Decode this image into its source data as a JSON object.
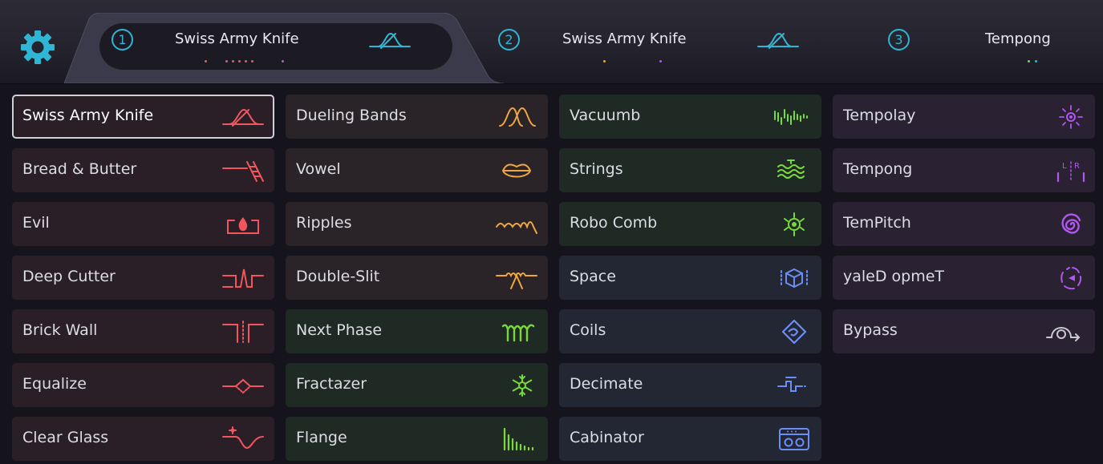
{
  "colors": {
    "red": "#f2555d",
    "orange": "#f0a640",
    "green": "#7ad93a",
    "blue": "#6c8df5",
    "purple": "#b156ee",
    "cyan": "#2fb6d4"
  },
  "top_bar": {
    "settings_icon": "gear-icon",
    "slots": [
      {
        "number": "1",
        "name": "Swiss Army Knife",
        "icon": "swiss-army-knife-icon",
        "active": true
      },
      {
        "number": "2",
        "name": "Swiss Army Knife",
        "icon": "swiss-army-knife-icon",
        "active": false
      },
      {
        "number": "3",
        "name": "Tempong",
        "icon": "tempong-icon",
        "active": false
      }
    ]
  },
  "modules": {
    "column_1": [
      {
        "label": "Swiss Army Knife",
        "icon": "swiss-army-knife-icon",
        "selected": true
      },
      {
        "label": "Bread & Butter",
        "icon": "ladder-icon"
      },
      {
        "label": "Evil",
        "icon": "flame-icon"
      },
      {
        "label": "Deep Cutter",
        "icon": "notch-icon"
      },
      {
        "label": "Brick Wall",
        "icon": "brick-wall-icon"
      },
      {
        "label": "Equalize",
        "icon": "diamond-line-icon"
      },
      {
        "label": "Clear Glass",
        "icon": "sparkle-curve-icon"
      }
    ],
    "column_2": [
      {
        "label": "Dueling Bands",
        "icon": "double-peak-icon"
      },
      {
        "label": "Vowel",
        "icon": "lips-icon"
      },
      {
        "label": "Ripples",
        "icon": "ripple-icon"
      },
      {
        "label": "Double-Slit",
        "icon": "slit-wave-icon"
      },
      {
        "label": "Next Phase",
        "icon": "coil-wave-icon"
      },
      {
        "label": "Fractazer",
        "icon": "snowflake-icon"
      },
      {
        "label": "Flange",
        "icon": "comb-bars-icon"
      }
    ],
    "column_3": [
      {
        "label": "Vacuumb",
        "icon": "pulse-bars-icon"
      },
      {
        "label": "Strings",
        "icon": "strings-icon"
      },
      {
        "label": "Robo Comb",
        "icon": "robot-eye-icon"
      },
      {
        "label": "Space",
        "icon": "cube-icon"
      },
      {
        "label": "Coils",
        "icon": "coil-icon"
      },
      {
        "label": "Decimate",
        "icon": "decimate-icon"
      },
      {
        "label": "Cabinator",
        "icon": "speaker-cabinet-icon"
      }
    ],
    "column_4": [
      {
        "label": "Tempolay",
        "icon": "radial-burst-icon"
      },
      {
        "label": "Tempong",
        "icon": "lr-bounce-icon"
      },
      {
        "label": "TemPitch",
        "icon": "spiral-icon"
      },
      {
        "label": "yaleD opmeT",
        "icon": "reverse-swirl-icon"
      },
      {
        "label": "Bypass",
        "icon": "bypass-arrow-icon"
      }
    ]
  }
}
